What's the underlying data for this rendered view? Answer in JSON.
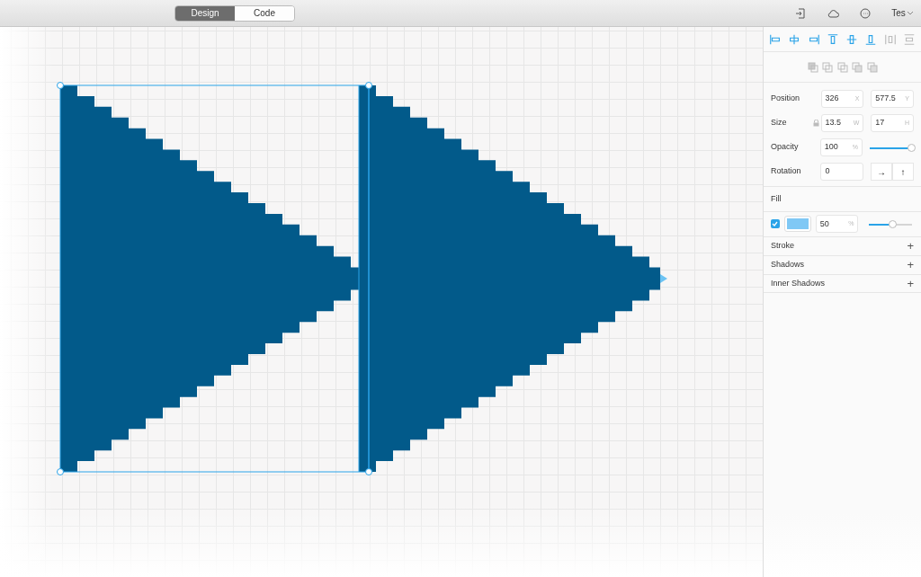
{
  "toolbar": {
    "tabs": [
      {
        "label": "Design",
        "selected": true
      },
      {
        "label": "Code",
        "selected": false
      }
    ],
    "user": "Tes"
  },
  "inspector": {
    "properties": [
      {
        "label": "Position",
        "lock": false,
        "fields": [
          {
            "value": "326",
            "unit": "X"
          },
          {
            "value": "577.5",
            "unit": "Y"
          }
        ]
      },
      {
        "label": "Size",
        "lock": true,
        "fields": [
          {
            "value": "13.5",
            "unit": "W"
          },
          {
            "value": "17",
            "unit": "H"
          }
        ]
      },
      {
        "label": "Opacity",
        "fields": [
          {
            "value": "100",
            "unit": "%"
          }
        ],
        "level": 1.0
      },
      {
        "label": "Rotation",
        "fields": [
          {
            "value": "0"
          }
        ],
        "flips": [
          "→",
          "↑"
        ]
      }
    ],
    "fill": {
      "title": "Fill",
      "checked": true,
      "value": "50",
      "unit": "%",
      "level": 0.5
    },
    "sections": [
      {
        "title": "Stroke",
        "action": "+"
      },
      {
        "title": "Shadows",
        "action": "+"
      },
      {
        "title": "Inner Shadows",
        "action": "+"
      }
    ]
  }
}
